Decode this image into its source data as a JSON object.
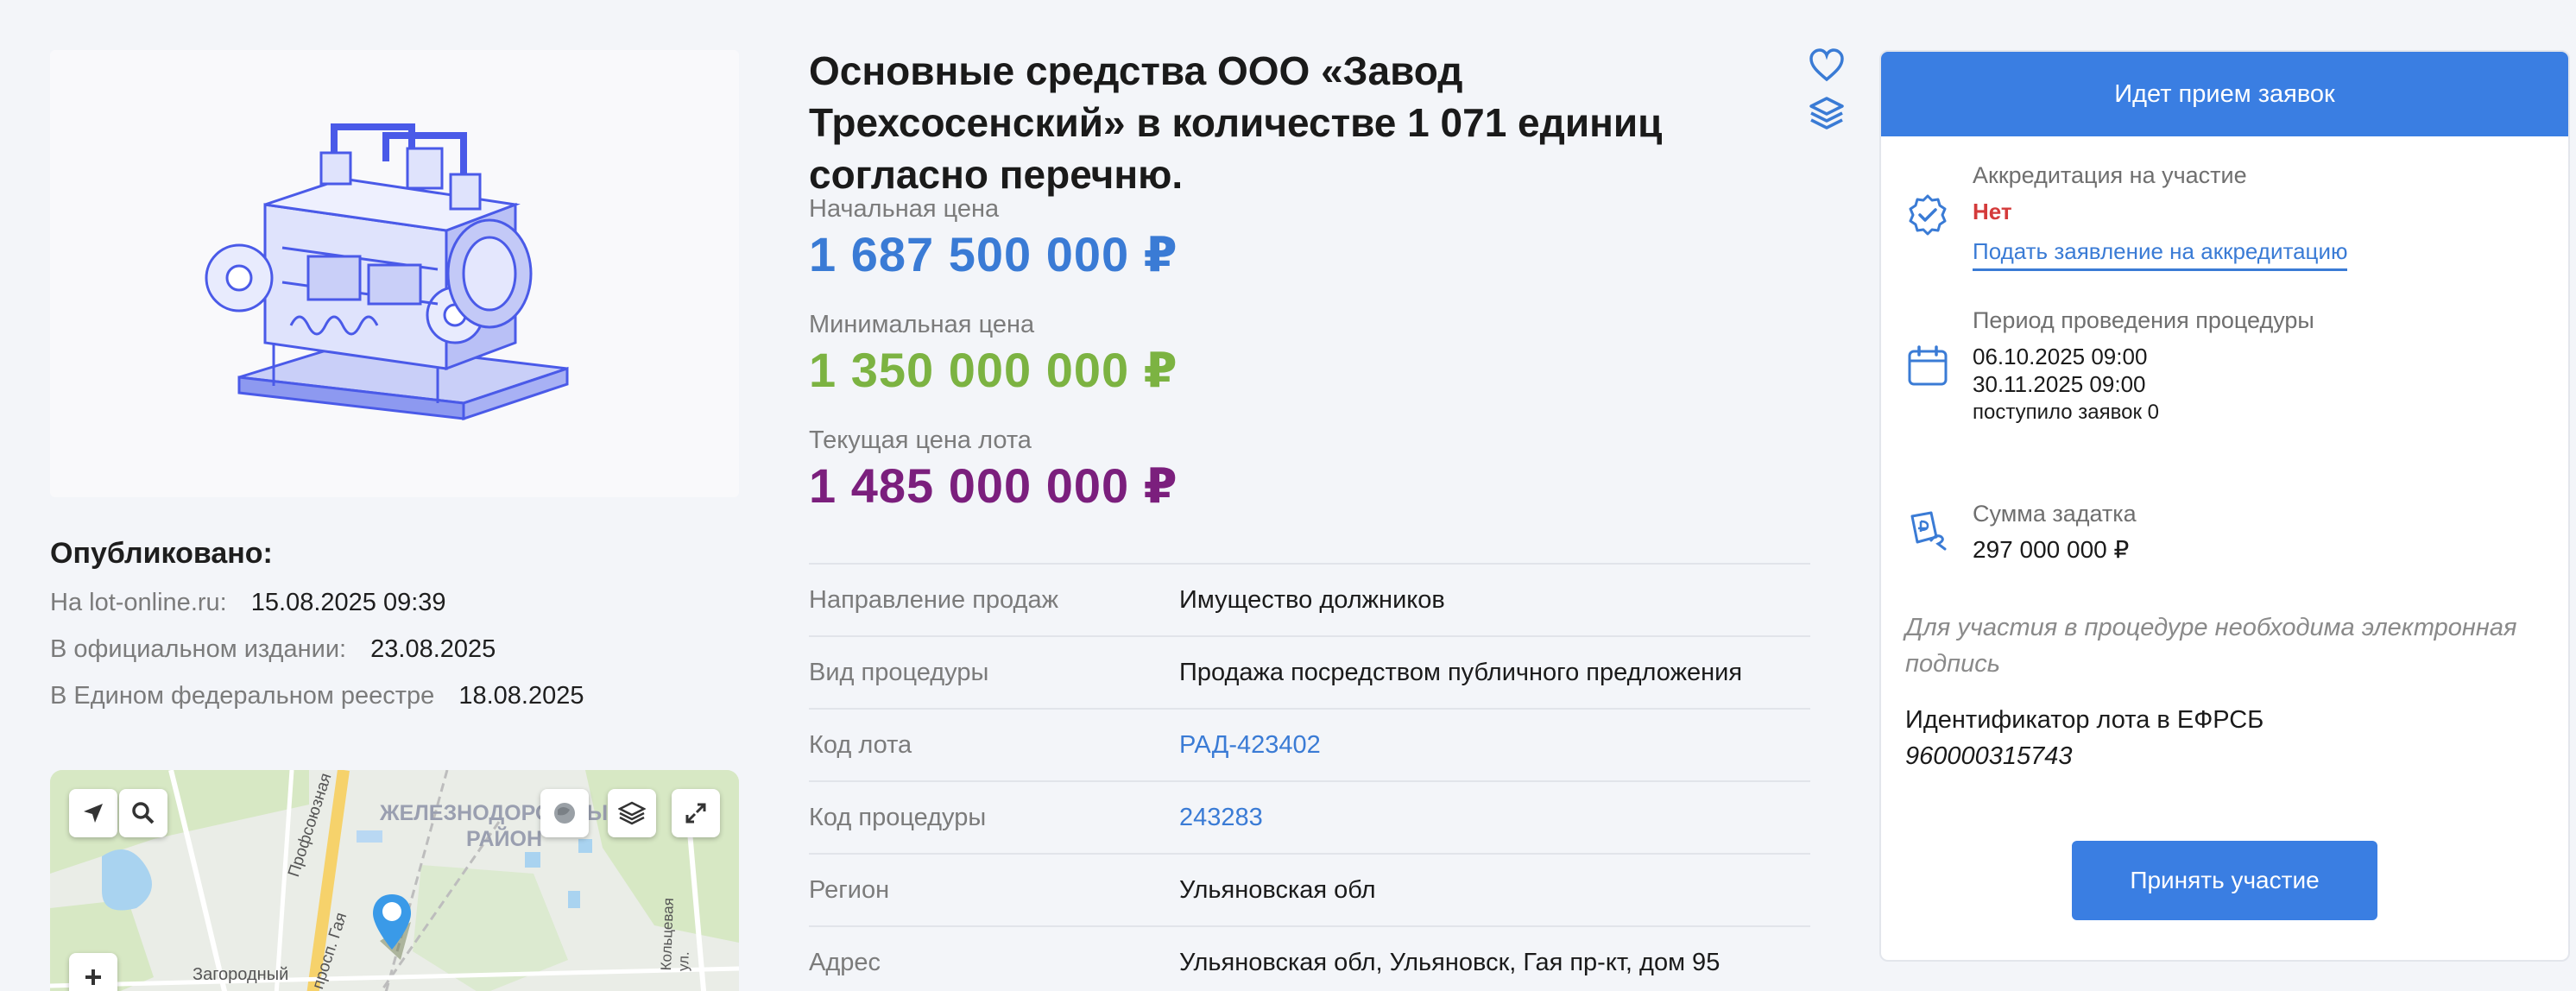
{
  "lot": {
    "title": "Основные средства ООО «Завод Трехсосенский» в количестве 1 071 единиц согласно перечню.",
    "image_icon": "industrial-machine-illustration"
  },
  "published": {
    "title": "Опубликовано:",
    "rows": [
      {
        "label": "На lot-online.ru:",
        "value": "15.08.2025 09:39"
      },
      {
        "label": "В официальном издании:",
        "value": "23.08.2025"
      },
      {
        "label": "В Едином федеральном реестре",
        "value": "18.08.2025"
      }
    ]
  },
  "map": {
    "labels": {
      "district": "ЖЕЛЕЗНОДОРОЖНЫЙ",
      "district2": "РАЙОН",
      "street1": "Профсоюзная",
      "street2": "просп. Гая",
      "street3": "Кольцевая ул.",
      "area": "Загородный"
    },
    "buttons": [
      "locate-icon",
      "search-icon",
      "satellite-icon",
      "layers-icon",
      "fullscreen-icon",
      "zoom-in-icon"
    ]
  },
  "prices": {
    "start_label": "Начальная цена",
    "start_value": "1 687 500 000  ₽",
    "min_label": "Минимальная цена",
    "min_value": "1 350 000 000  ₽",
    "current_label": "Текущая цена лота",
    "current_value": "1 485 000 000  ₽"
  },
  "info": [
    {
      "key": "Направление продаж",
      "value": "Имущество должников"
    },
    {
      "key": "Вид процедуры",
      "value": "Продажа посредством публичного предложения"
    },
    {
      "key": "Код лота",
      "value": "РАД-423402"
    },
    {
      "key": "Код процедуры",
      "value": "243283"
    },
    {
      "key": "Регион",
      "value": "Ульяновская обл"
    },
    {
      "key": "Адрес",
      "value": "Ульяновская обл, Ульяновск, Гая пр-кт, дом 95"
    }
  ],
  "card": {
    "status": "Идет прием заявок",
    "accreditation_label": "Аккредитация на участие",
    "accreditation_value": "Нет",
    "accreditation_link": "Подать заявление на аккредитацию",
    "period_label": "Период проведения процедуры",
    "period_start": "06.10.2025 09:00",
    "period_end": "30.11.2025 09:00",
    "applications": "поступило заявок 0",
    "deposit_label": "Сумма задатка",
    "deposit_value": "297 000 000 ₽",
    "sign_note": "Для участия в процедуре необходима электронная подпись",
    "efrsb_label": "Идентификатор лота в ЕФРСБ",
    "efrsb_value": "960000315743",
    "participate_button": "Принять участие"
  },
  "colors": {
    "accent": "#3a7ee2",
    "start_price": "#3a7bd5",
    "min_price": "#7cb342",
    "current_price": "#7b1f7d",
    "negative": "#d43b3b"
  }
}
